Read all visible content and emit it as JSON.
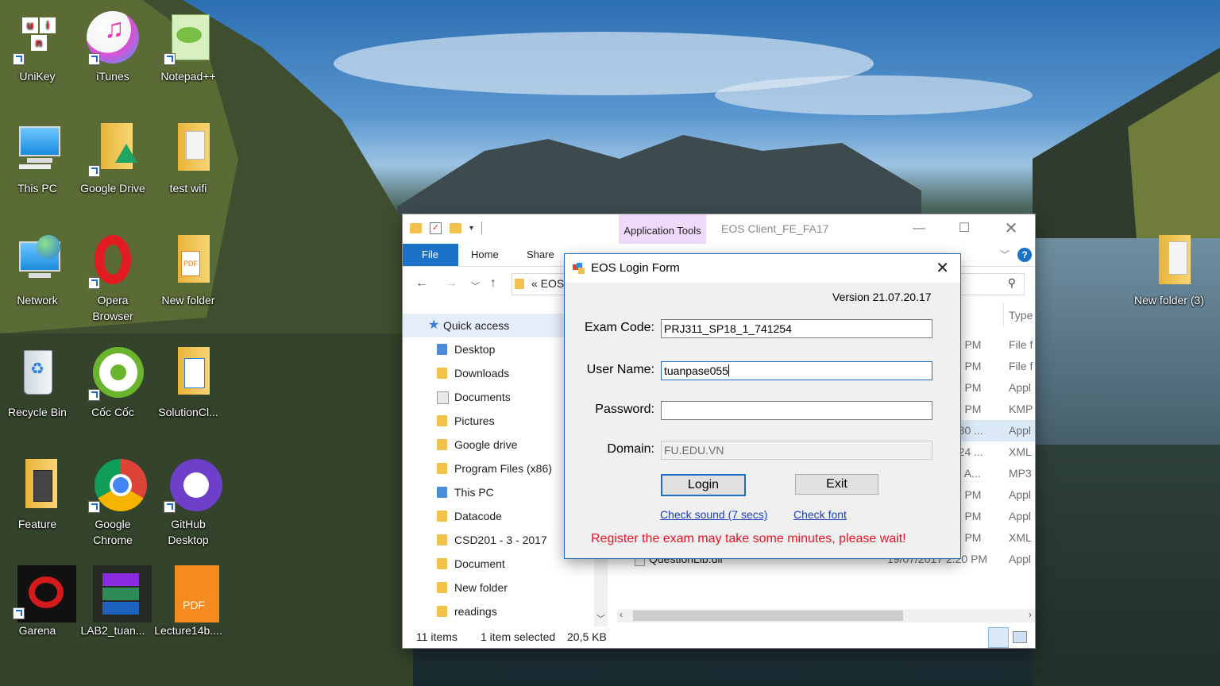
{
  "desktop": {
    "icons": [
      {
        "label": "UniKey"
      },
      {
        "label": "iTunes"
      },
      {
        "label": "Notepad++"
      },
      {
        "label": "This PC"
      },
      {
        "label": "Google Drive"
      },
      {
        "label": "test wifi"
      },
      {
        "label": "Network"
      },
      {
        "label": "Opera Browser"
      },
      {
        "label": "New folder"
      },
      {
        "label": "Recycle Bin"
      },
      {
        "label": "Cốc Cốc"
      },
      {
        "label": "SolutionCl..."
      },
      {
        "label": "Feature"
      },
      {
        "label": "Google Chrome"
      },
      {
        "label": "GitHub Desktop"
      },
      {
        "label": "Garena"
      },
      {
        "label": "LAB2_tuan..."
      },
      {
        "label": "Lecture14b...."
      },
      {
        "label": "New folder (3)"
      }
    ]
  },
  "explorer": {
    "title": "EOS Client_FE_FA17",
    "app_tools": "Application Tools",
    "tabs": {
      "file": "File",
      "home": "Home",
      "share": "Share"
    },
    "address": "« EOS",
    "nav": {
      "quick_access": "Quick access",
      "items": [
        "Desktop",
        "Downloads",
        "Documents",
        "Pictures",
        "Google drive",
        "Program Files (x86)",
        "This PC",
        "Datacode",
        "CSD201 - 3 - 2017",
        "Document",
        "New folder",
        "readings"
      ]
    },
    "columns": {
      "type": "Type"
    },
    "rows": [
      {
        "date": "30 PM",
        "type": "File f"
      },
      {
        "date": "08 PM",
        "type": "File f"
      },
      {
        "date": "04 PM",
        "type": "Appl"
      },
      {
        "date": "05 PM",
        "type": "KMP"
      },
      {
        "date": "0:30 ...",
        "type": "Appl"
      },
      {
        "date": "2:24 ...",
        "type": "XML"
      },
      {
        "date": "07 A...",
        "type": "MP3"
      },
      {
        "date": "20 PM",
        "type": "Appl"
      },
      {
        "date": "56 PM",
        "type": "Appl"
      },
      {
        "date": "56 PM",
        "type": "XML"
      },
      {
        "name": "QuestionLib.dll",
        "date": "19/07/2017 2:20 PM",
        "type": "Appl"
      }
    ],
    "status": {
      "items": "11 items",
      "selected": "1 item selected",
      "size": "20,5 KB"
    }
  },
  "login": {
    "title": "EOS Login Form",
    "version": "Version 21.07.20.17",
    "exam_code_label": "Exam Code:",
    "exam_code_value": "PRJ311_SP18_1_741254",
    "username_label": "User Name:",
    "username_value": "tuanpase055",
    "password_label": "Password:",
    "password_value": "",
    "domain_label": "Domain:",
    "domain_value": "FU.EDU.VN",
    "login_button": "Login",
    "exit_button": "Exit",
    "check_sound": "Check sound (7 secs)",
    "check_font": "Check font",
    "warning": "Register the exam may take some minutes, please wait!",
    "warning_color": "#e81123"
  }
}
